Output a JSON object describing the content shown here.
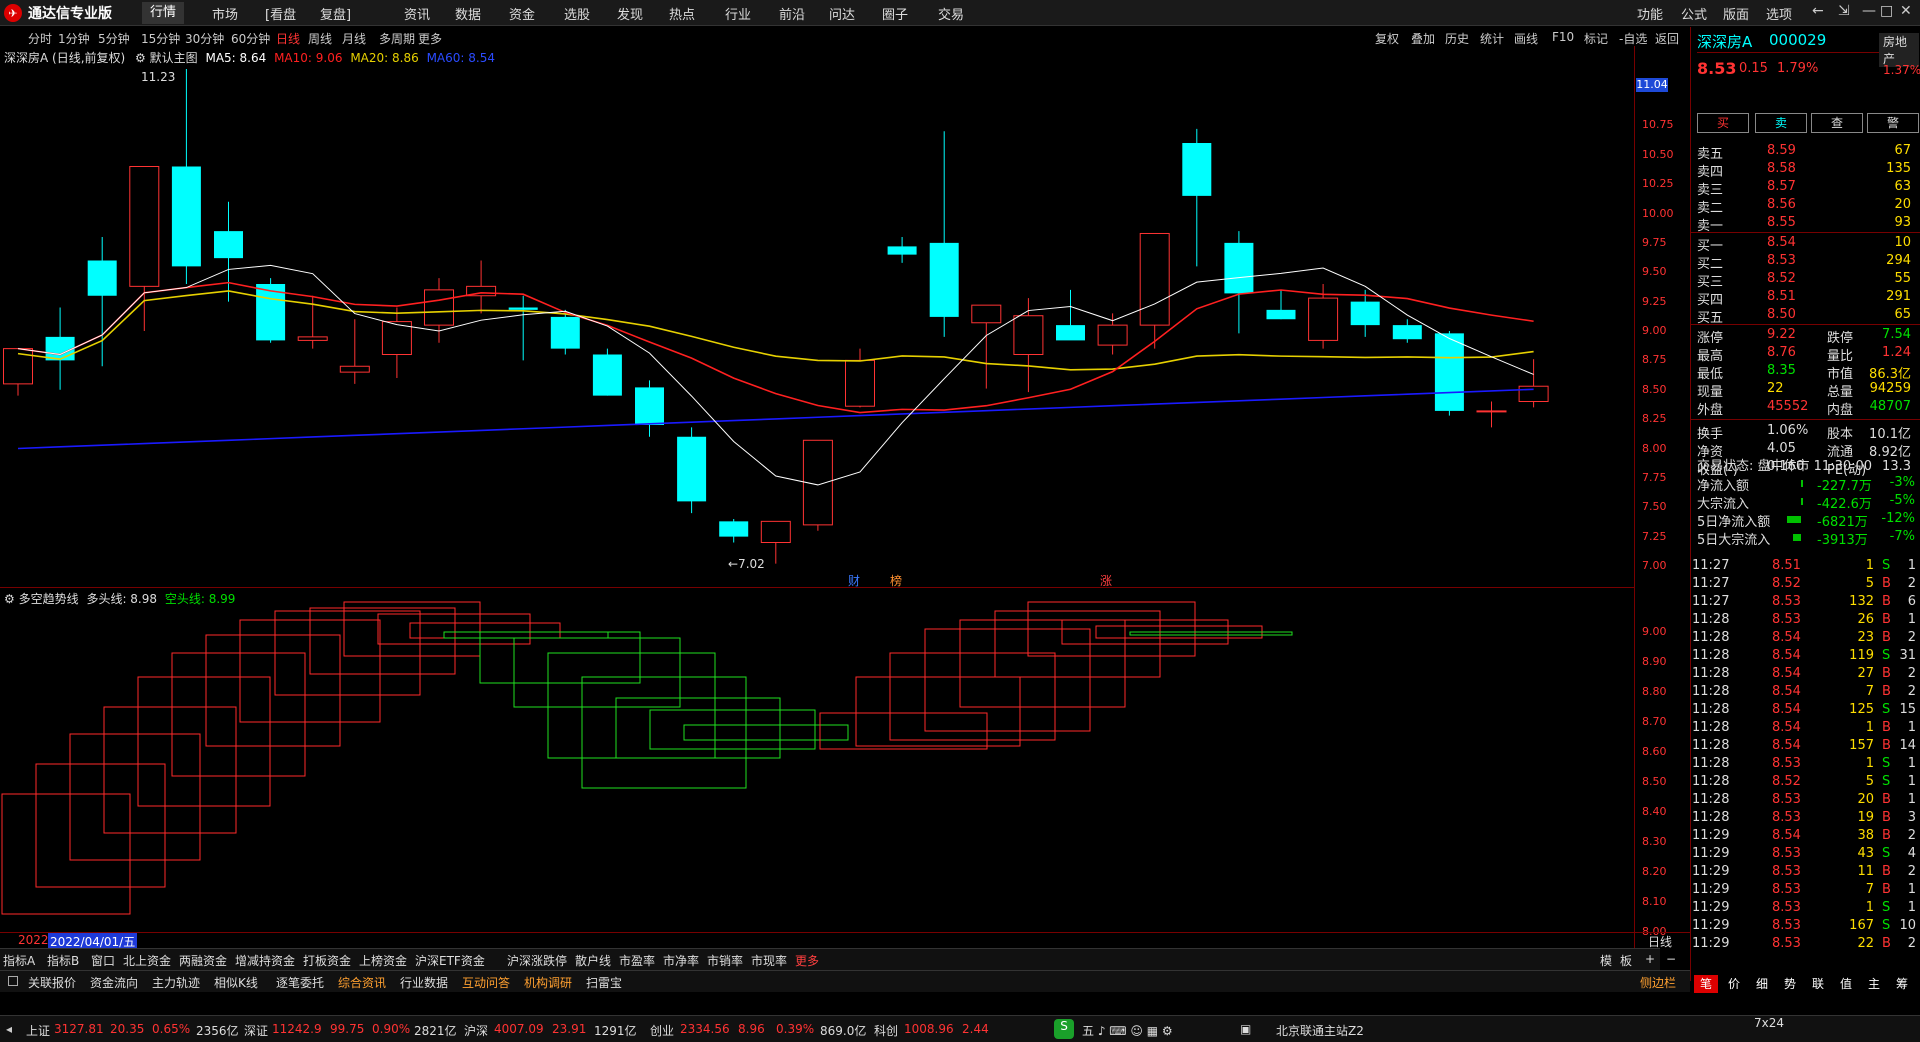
{
  "app": {
    "logo_text": "通达信专业版"
  },
  "menu": [
    "行情",
    "市场",
    "[看盘",
    "复盘]",
    "资讯",
    "数据",
    "资金",
    "选股",
    "发现",
    "热点",
    "行业",
    "前沿",
    "问达",
    "圈子",
    "交易"
  ],
  "right_menu": [
    "功能",
    "公式",
    "版面",
    "选项"
  ],
  "periods": [
    "分时",
    "1分钟",
    "5分钟",
    "15分钟",
    "30分钟",
    "60分钟",
    "日线",
    "周线",
    "月线",
    "多周期",
    "更多"
  ],
  "toolbar": [
    "复权",
    "叠加",
    "历史",
    "统计",
    "画线",
    "F10",
    "标记",
    "-自选",
    "返回"
  ],
  "main_legend": {
    "title": "深深房A (日线,前复权)",
    "theme": "默认主图",
    "ma5": "MA5: 8.64",
    "ma10": "MA10: 9.06",
    "ma20": "MA20: 8.86",
    "ma60": "MA60: 8.54"
  },
  "colors": {
    "ma5": "#ffffff",
    "ma10": "#ff2020",
    "ma20": "#e6d000",
    "ma60": "#1a1aff",
    "bull": "#ff3333",
    "bear": "#00ffff"
  },
  "price_axis": [
    "11.04",
    "10.75",
    "10.50",
    "10.25",
    "10.00",
    "9.75",
    "9.50",
    "9.25",
    "9.00",
    "8.75",
    "8.50",
    "8.25",
    "8.00",
    "7.75",
    "7.50",
    "7.25",
    "7.00"
  ],
  "annotations": {
    "high": "11.23",
    "low": "←7.02",
    "badge1": "财",
    "badge2": "榜",
    "badge3": "涨"
  },
  "sub_legend": {
    "name": "多空趋势线",
    "long": "多头线: 8.98",
    "short": "空头线: 8.99"
  },
  "sub_axis": [
    "9.00",
    "8.90",
    "8.80",
    "8.70",
    "8.60",
    "8.50",
    "8.40",
    "8.30",
    "8.20",
    "8.10",
    "8.00"
  ],
  "date_bar": {
    "year": "2022",
    "date": "2022/04/01/五",
    "period": "日线"
  },
  "bottom_tabs": [
    "指标A",
    "指标B",
    "窗口",
    "北上资金",
    "两融资金",
    "增减持资金",
    "打板资金",
    "上榜资金",
    "沪深ETF资金",
    "沪深涨跌停",
    "散户线",
    "市盈率",
    "市净率",
    "市销率",
    "市现率",
    "更多"
  ],
  "bottom_right": [
    "模",
    "板",
    "+",
    "−"
  ],
  "tabs2": [
    "关联报价",
    "资金流向",
    "主力轨迹",
    "相似K线",
    "逐笔委托",
    "综合资讯",
    "行业数据",
    "互动问答",
    "机构调研",
    "扫雷宝"
  ],
  "tabs2_right": "侧边栏",
  "quote": {
    "name": "深深房A",
    "code": "000029",
    "price": "8.53",
    "change": "0.15",
    "pct": "1.79%",
    "sector": "房地产",
    "sector_pct": "1.37%",
    "buttons": [
      "买",
      "卖",
      "查",
      "警"
    ]
  },
  "asks": [
    {
      "l": "卖五",
      "p": "8.59",
      "v": "67"
    },
    {
      "l": "卖四",
      "p": "8.58",
      "v": "135"
    },
    {
      "l": "卖三",
      "p": "8.57",
      "v": "63"
    },
    {
      "l": "卖二",
      "p": "8.56",
      "v": "20"
    },
    {
      "l": "卖一",
      "p": "8.55",
      "v": "93"
    }
  ],
  "bids": [
    {
      "l": "买一",
      "p": "8.54",
      "v": "10"
    },
    {
      "l": "买二",
      "p": "8.53",
      "v": "294"
    },
    {
      "l": "买三",
      "p": "8.52",
      "v": "55"
    },
    {
      "l": "买四",
      "p": "8.51",
      "v": "291"
    },
    {
      "l": "买五",
      "p": "8.50",
      "v": "65"
    }
  ],
  "stats": [
    [
      "涨停",
      "9.22",
      "跌停",
      "7.54"
    ],
    [
      "最高",
      "8.76",
      "量比",
      "1.24"
    ],
    [
      "最低",
      "8.35",
      "市值",
      "86.3亿"
    ],
    [
      "现量",
      "22",
      "总量",
      "94259"
    ],
    [
      "外盘",
      "45552",
      "内盘",
      "48707"
    ]
  ],
  "stats2": [
    [
      "换手",
      "1.06%",
      "股本",
      "10.1亿"
    ],
    [
      "净资",
      "4.05",
      "流通",
      "8.92亿"
    ],
    [
      "收益(-)",
      "0.160",
      "PE(动)",
      "13.3"
    ]
  ],
  "trade_state": "交易状态: 盘中休市 11:30:00",
  "flows": [
    {
      "l": "净流入额",
      "v": "-227.7万",
      "p": "-3%",
      "bar": 0.02
    },
    {
      "l": "大宗流入",
      "v": "-422.6万",
      "p": "-5%",
      "bar": 0.02
    },
    {
      "l": "5日净流入额",
      "v": "-6821万",
      "p": "-12%",
      "bar": 0.7
    },
    {
      "l": "5日大宗流入",
      "v": "-3913万",
      "p": "-7%",
      "bar": 0.4
    }
  ],
  "trades": [
    [
      "11:27",
      "8.51",
      "1",
      "S",
      "1"
    ],
    [
      "11:27",
      "8.52",
      "5",
      "B",
      "2"
    ],
    [
      "11:27",
      "8.53",
      "132",
      "B",
      "6"
    ],
    [
      "11:28",
      "8.53",
      "26",
      "B",
      "1"
    ],
    [
      "11:28",
      "8.54",
      "23",
      "B",
      "2"
    ],
    [
      "11:28",
      "8.54",
      "119",
      "S",
      "31"
    ],
    [
      "11:28",
      "8.54",
      "27",
      "B",
      "2"
    ],
    [
      "11:28",
      "8.54",
      "7",
      "B",
      "2"
    ],
    [
      "11:28",
      "8.54",
      "125",
      "S",
      "15"
    ],
    [
      "11:28",
      "8.54",
      "1",
      "B",
      "1"
    ],
    [
      "11:28",
      "8.54",
      "157",
      "B",
      "14"
    ],
    [
      "11:28",
      "8.53",
      "1",
      "S",
      "1"
    ],
    [
      "11:28",
      "8.52",
      "5",
      "S",
      "1"
    ],
    [
      "11:28",
      "8.53",
      "20",
      "B",
      "1"
    ],
    [
      "11:28",
      "8.53",
      "19",
      "B",
      "3"
    ],
    [
      "11:29",
      "8.54",
      "38",
      "B",
      "2"
    ],
    [
      "11:29",
      "8.53",
      "43",
      "S",
      "4"
    ],
    [
      "11:29",
      "8.53",
      "11",
      "B",
      "2"
    ],
    [
      "11:29",
      "8.53",
      "7",
      "B",
      "1"
    ],
    [
      "11:29",
      "8.53",
      "1",
      "S",
      "1"
    ],
    [
      "11:29",
      "8.53",
      "167",
      "S",
      "10"
    ],
    [
      "11:29",
      "8.53",
      "22",
      "B",
      "2"
    ]
  ],
  "side_tabs": [
    "笔",
    "价",
    "细",
    "势",
    "联",
    "值",
    "主",
    "筹"
  ],
  "status": {
    "sh_label": "上证",
    "sh": "3127.81",
    "sh_chg": "20.35",
    "sh_pct": "0.65%",
    "sh_amt": "2356亿",
    "sz_label": "深证",
    "sz": "11242.9",
    "sz_chg": "99.75",
    "sz_pct": "0.90%",
    "sz_amt": "2821亿",
    "hs_label": "沪深",
    "hs": "4007.09",
    "hs_chg": "23.91",
    "hs_amt": "1291亿",
    "cy_label": "创业",
    "cy": "2334.56",
    "cy_chg": "8.96",
    "cy_pct": "0.39%",
    "cy_amt": "869.0亿",
    "kc_label": "科创",
    "kc": "1008.96",
    "kc_chg": "2.44",
    "server": "北京联通主站Z2",
    "grid": "7x24"
  },
  "chart_data": {
    "type": "candlestick",
    "ohlc": [
      [
        8.55,
        8.75,
        8.45,
        8.85
      ],
      [
        8.95,
        9.2,
        8.5,
        8.75
      ],
      [
        9.6,
        9.8,
        8.7,
        9.3
      ],
      [
        9.38,
        10.25,
        9.0,
        10.4
      ],
      [
        10.4,
        11.23,
        9.4,
        9.55
      ],
      [
        9.85,
        10.1,
        9.25,
        9.62
      ],
      [
        9.4,
        9.45,
        8.9,
        8.92
      ],
      [
        8.92,
        9.3,
        8.85,
        8.95
      ],
      [
        8.65,
        9.1,
        8.55,
        8.7
      ],
      [
        8.8,
        9.2,
        8.6,
        9.08
      ],
      [
        9.05,
        9.45,
        8.9,
        9.35
      ],
      [
        9.3,
        9.6,
        9.15,
        9.38
      ],
      [
        9.2,
        9.3,
        8.75,
        9.18
      ],
      [
        9.12,
        9.18,
        8.8,
        8.85
      ],
      [
        8.8,
        8.85,
        8.45,
        8.45
      ],
      [
        8.52,
        8.58,
        8.1,
        8.2
      ],
      [
        8.1,
        8.18,
        7.45,
        7.55
      ],
      [
        7.38,
        7.4,
        7.2,
        7.25
      ],
      [
        7.2,
        7.35,
        7.02,
        7.38
      ],
      [
        7.35,
        7.7,
        7.3,
        8.07
      ],
      [
        8.36,
        8.85,
        8.35,
        8.75
      ],
      [
        9.72,
        9.8,
        9.58,
        9.65
      ],
      [
        9.75,
        10.7,
        8.95,
        9.12
      ],
      [
        9.07,
        9.2,
        8.51,
        9.22
      ],
      [
        8.8,
        9.28,
        8.48,
        9.13
      ],
      [
        9.05,
        9.35,
        8.98,
        8.92
      ],
      [
        8.88,
        9.15,
        8.8,
        9.05
      ],
      [
        9.05,
        9.4,
        8.85,
        9.83
      ],
      [
        10.6,
        10.72,
        9.55,
        10.15
      ],
      [
        9.75,
        9.85,
        8.98,
        9.32
      ],
      [
        9.18,
        9.35,
        9.1,
        9.1
      ],
      [
        8.92,
        9.4,
        8.85,
        9.28
      ],
      [
        9.25,
        9.35,
        8.95,
        9.05
      ],
      [
        9.05,
        9.1,
        8.9,
        8.93
      ],
      [
        8.98,
        9.0,
        8.28,
        8.32
      ],
      [
        8.32,
        8.4,
        8.18,
        8.32
      ],
      [
        8.4,
        8.76,
        8.35,
        8.53
      ]
    ]
  }
}
